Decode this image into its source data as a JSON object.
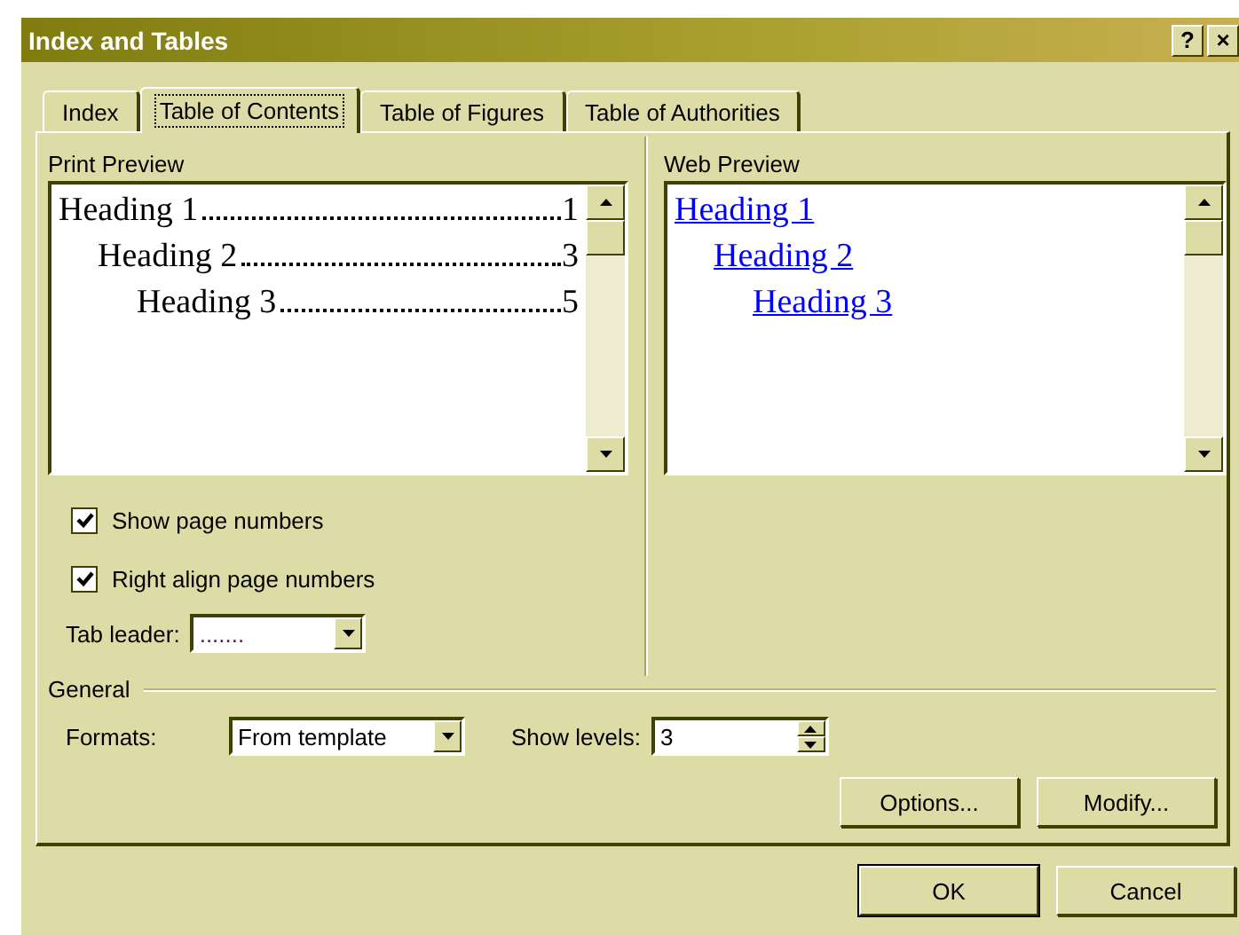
{
  "window": {
    "title": "Index and Tables",
    "help": "?",
    "close": "×"
  },
  "tabs": [
    {
      "label": "Index",
      "selected": false
    },
    {
      "label": "Table of Contents",
      "selected": true
    },
    {
      "label": "Table of Figures",
      "selected": false
    },
    {
      "label": "Table of Authorities",
      "selected": false
    }
  ],
  "print_preview": {
    "label": "Print Preview",
    "entries": [
      {
        "text": "Heading 1",
        "page": "1",
        "children": [
          {
            "text": "Heading 2",
            "page": "3",
            "children": [
              {
                "text": "Heading 3",
                "page": "5"
              }
            ]
          }
        ]
      }
    ]
  },
  "web_preview": {
    "label": "Web Preview",
    "entries": [
      {
        "text": "Heading 1",
        "children": [
          {
            "text": "Heading 2",
            "children": [
              {
                "text": "Heading 3"
              }
            ]
          }
        ]
      }
    ]
  },
  "checkboxes": [
    {
      "label": "Show page numbers",
      "checked": true
    },
    {
      "label": "Right align page numbers",
      "checked": true
    }
  ],
  "tab_leader": {
    "label": "Tab leader:",
    "value": "......."
  },
  "general": {
    "label": "General",
    "formats": {
      "label": "Formats:",
      "value": "From template"
    },
    "show_levels": {
      "label": "Show levels:",
      "value": "3"
    }
  },
  "panel_buttons": [
    "Options...",
    "Modify..."
  ],
  "dialog_buttons": [
    "OK",
    "Cancel"
  ]
}
